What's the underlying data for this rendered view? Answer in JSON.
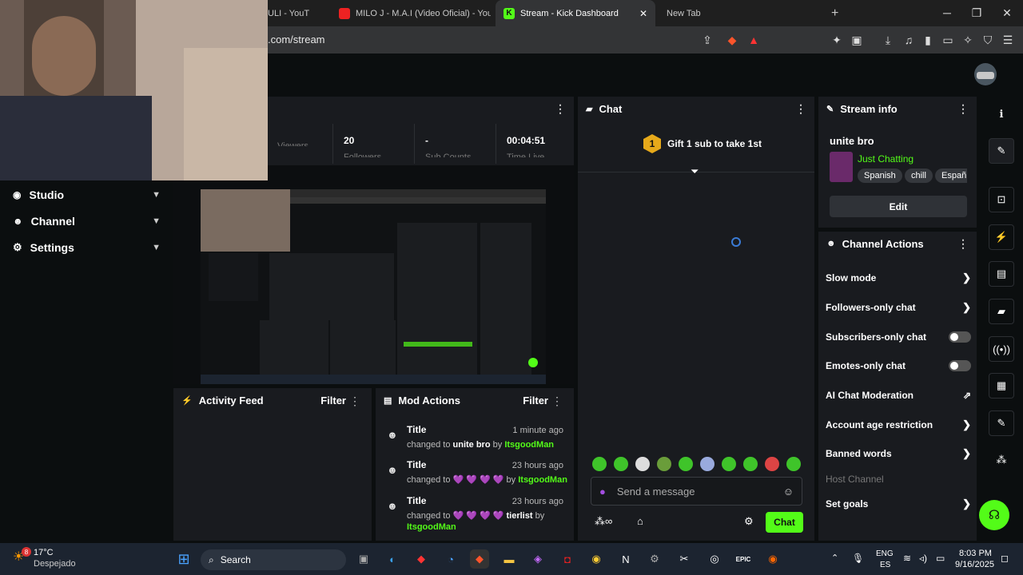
{
  "browser": {
    "tabs": [
      {
        "label": "ON JULI - YouT",
        "color": "#d21"
      },
      {
        "label": "MILO J - M.A.I (Video Oficial) - YouTu",
        "color": "#e22"
      },
      {
        "label": "Stream - Kick Dashboard",
        "color": "#53fc18"
      },
      {
        "label": "New Tab",
        "color": ""
      }
    ],
    "new_tab_symbol": "+",
    "url": ".com/stream"
  },
  "nav": {
    "items": [
      {
        "label": "Studio",
        "icon": "broadcast-icon"
      },
      {
        "label": "Channel",
        "icon": "users-icon"
      },
      {
        "label": "Settings",
        "icon": "gear-icon"
      }
    ]
  },
  "stats": [
    {
      "value": "",
      "label": "Viewers"
    },
    {
      "value": "20",
      "label": "Followers"
    },
    {
      "value": "-",
      "label": "Sub Counts"
    },
    {
      "value": "00:04:51",
      "label": "Time Live"
    }
  ],
  "activity_feed": {
    "title": "Activity Feed",
    "filter": "Filter"
  },
  "mod_actions": {
    "title": "Mod Actions",
    "filter": "Filter",
    "rows": [
      {
        "title": "Title",
        "time": "1 minute ago",
        "prefix": "changed to",
        "value": "unite bro",
        "by": "by",
        "user": "ItsgoodMan"
      },
      {
        "title": "Title",
        "time": "23 hours ago",
        "prefix": "changed to",
        "value": "💜 💜 💜 💜",
        "by": "by",
        "user": "ItsgoodMan"
      },
      {
        "title": "Title",
        "time": "23 hours ago",
        "prefix": "changed to",
        "value": "💜 💜 💜 💜 tierlist",
        "by": "by",
        "user": "ItsgoodMan"
      }
    ]
  },
  "chat": {
    "title": "Chat",
    "gift_rank": "1",
    "gift_text": "Gift 1 sub to take 1st",
    "placeholder": "Send a message",
    "send_label": "Chat"
  },
  "stream_info": {
    "title": "Stream info",
    "stream_title": "unite bro",
    "category": "Just Chatting",
    "tags": [
      "Spanish",
      "chill",
      "Españ"
    ],
    "edit_label": "Edit"
  },
  "channel_actions": {
    "title": "Channel Actions",
    "items": [
      {
        "label": "Slow mode",
        "control": "chevron"
      },
      {
        "label": "Followers-only chat",
        "control": "chevron"
      },
      {
        "label": "Subscribers-only chat",
        "control": "toggle"
      },
      {
        "label": "Emotes-only chat",
        "control": "toggle"
      },
      {
        "label": "AI Chat Moderation",
        "control": "external"
      },
      {
        "label": "Account age restriction",
        "control": "chevron"
      },
      {
        "label": "Banned words",
        "control": "chevron"
      },
      {
        "label": "Host Channel",
        "control": "none"
      },
      {
        "label": "Set goals",
        "control": "chevron"
      }
    ]
  },
  "taskbar": {
    "weather_temp": "17°C",
    "weather_desc": "Despejado",
    "weather_badge": "8",
    "search": "Search",
    "lang_top": "ENG",
    "lang_bottom": "ES",
    "time": "8:03 PM",
    "date": "9/16/2025"
  },
  "colors": {
    "accent": "#53fc18",
    "panel": "#191b1f",
    "background": "#0b0e0f"
  }
}
